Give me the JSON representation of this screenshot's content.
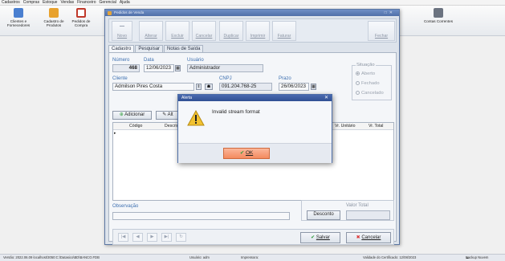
{
  "menu": [
    "Cadastros",
    "Compras",
    "Estoque",
    "Vendas",
    "Financeiro",
    "Gerencial",
    "Ajuda"
  ],
  "toolbar": [
    {
      "label": "Clientes e Fornecedores",
      "icon": "clients-icon",
      "color": "#4a7fd0"
    },
    {
      "label": "Cadastro de Produtos",
      "icon": "products-box-icon",
      "color": "#e8a22e"
    },
    {
      "label": "Pedidos de Compra",
      "icon": "purchase-orders-icon",
      "color": "#c0392b"
    },
    {
      "label": "Contas Correntes",
      "icon": "accounts-icon",
      "color": "#6b7380"
    }
  ],
  "window": {
    "title": "Pedidos de Venda",
    "buttons": [
      "Novo",
      "Alterar",
      "Excluir",
      "Cancelar",
      "Duplicar",
      "Imprimir",
      "Faturar",
      "Fechar"
    ],
    "tabs": [
      "Cadastro",
      "Pesquisar",
      "Notas de Saída"
    ],
    "fields": {
      "numero_label": "Número",
      "numero_value": "468",
      "data_label": "Data",
      "data_value": "12/06/2023",
      "usuario_label": "Usuário",
      "usuario_value": "Administrador",
      "cliente_label": "Cliente",
      "cliente_value": "Admilson Pires Costa",
      "cnpj_label": "CNPJ",
      "cnpj_value": "091.204.768-25",
      "prazo_label": "Prazo",
      "prazo_value": "26/06/2023"
    },
    "situacao": {
      "label": "Situação",
      "options": [
        "Aberto",
        "Fechado",
        "Cancelado"
      ],
      "selected": "Aberto"
    },
    "item_buttons": {
      "add": "Adicionar",
      "alter_partial": "Alt"
    },
    "grid_columns": [
      "Código",
      "Descriç",
      "Vr. Unitário",
      "Vr. Total"
    ],
    "observacao_label": "Observação",
    "valor_total_label": "Valor Total",
    "desconto": "Desconto",
    "salvar": "Salvar",
    "cancelar": "Cancelar",
    "nav": [
      "|◀",
      "◀",
      "▶",
      "▶|",
      "↻"
    ]
  },
  "dialog": {
    "title": "Alerta",
    "message": "Invalid stream format",
    "ok": "OK"
  },
  "status": {
    "version": "Versão: 2022.06.09  localhost/3050:C:\\Datasico\\BD\\BANCO.FDB",
    "user": "Usuário: adm",
    "printer": "Impressora:",
    "cert": "Validade do Certificado: 12/08/2023",
    "backup": "Backup Nuvem"
  }
}
